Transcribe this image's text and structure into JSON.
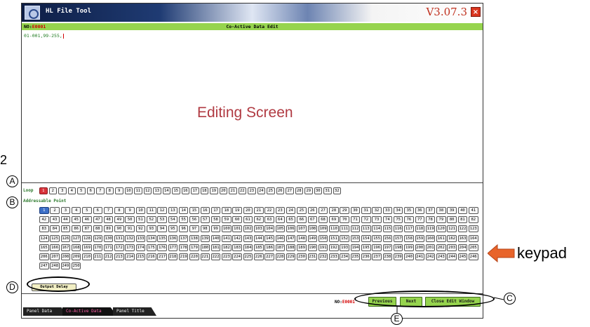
{
  "window": {
    "app_title": "HL File Tool",
    "version": "V3.07.3",
    "close_symbol": "×"
  },
  "header": {
    "no_prefix": "NO:",
    "no_value": "E0001",
    "title": "Co-Active Data Edit"
  },
  "editor": {
    "content": "01-001,99-255,",
    "overlay_label": "Editing Screen"
  },
  "loop": {
    "label": "Loop",
    "selected": 1,
    "keys": [
      "1",
      "2",
      "3",
      "4",
      "5",
      "6",
      "7",
      "8",
      "9",
      "10",
      "11",
      "12",
      "13",
      "14",
      "15",
      "16",
      "17",
      "18",
      "19",
      "20",
      "21",
      "22",
      "23",
      "24",
      "25",
      "26",
      "27",
      "28",
      "29",
      "30",
      "31",
      "32"
    ]
  },
  "addressable": {
    "label": "Addressable Point",
    "selected": 1,
    "count": 250
  },
  "output_delay_label": "Output Delay",
  "tabs": [
    {
      "label": "Panel Data",
      "active": false
    },
    {
      "label": "Co-Active Data",
      "active": true
    },
    {
      "label": "Panel Title",
      "active": false
    }
  ],
  "footer": {
    "no_prefix": "NO:",
    "no_value": "E0001",
    "previous_label": "Previous",
    "next_label": "Next",
    "close_edit_label": "Close Edit Window"
  },
  "annotations": {
    "label_2": "2",
    "A": "A",
    "B": "B",
    "C": "C",
    "D": "D",
    "E": "E",
    "keypad": "keypad"
  },
  "colors": {
    "header_green": "#96d44e",
    "selected_loop": "#d8323a",
    "selected_point": "#3c6fc7",
    "arrow": "#e8642a"
  }
}
